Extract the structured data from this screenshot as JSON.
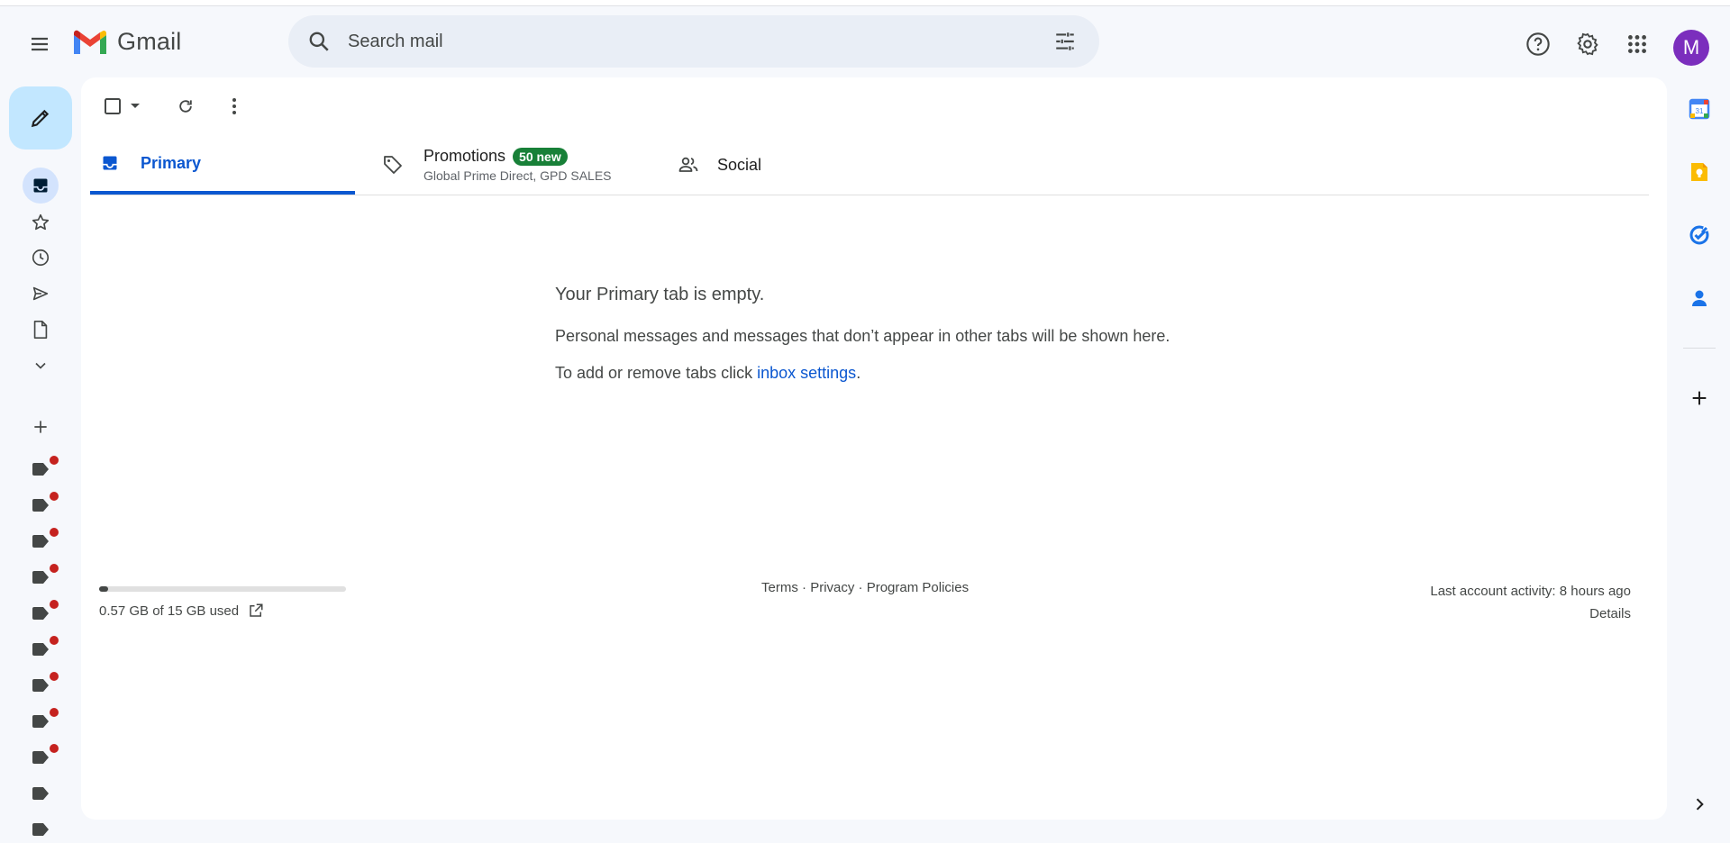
{
  "header": {
    "logo_text": "Gmail",
    "search_placeholder": "Search mail",
    "avatar_letter": "M"
  },
  "toolbar": {},
  "tabs": [
    {
      "label": "Primary"
    },
    {
      "label": "Promotions",
      "badge": "50 new",
      "subtitle": "Global Prime Direct, GPD SALES"
    },
    {
      "label": "Social"
    }
  ],
  "empty_state": {
    "title": "Your Primary tab is empty.",
    "line1": "Personal messages and messages that don’t appear in other tabs will be shown here.",
    "line2_prefix": "To add or remove tabs click ",
    "line2_link": "inbox settings",
    "line2_suffix": "."
  },
  "footer": {
    "storage_text": "0.57 GB of 15 GB used",
    "storage_fraction": 0.038,
    "terms": "Terms",
    "privacy": "Privacy",
    "program_policies": "Program Policies",
    "separator": " · ",
    "last_activity": "Last account activity: 8 hours ago",
    "details": "Details"
  },
  "colors": {
    "accent": "#0b57d0",
    "compose_bg": "#c2e7ff",
    "badge_green": "#188038",
    "label_dot": "#c5221f",
    "avatar": "#7b2ebd"
  },
  "icons": {
    "rail": [
      "inbox-icon",
      "star-icon",
      "clock-icon",
      "send-icon",
      "draft-icon",
      "chevron-down-icon"
    ],
    "side_panel": [
      "calendar-icon",
      "keep-icon",
      "tasks-icon",
      "contacts-icon",
      "plus-icon",
      "chevron-right-icon"
    ]
  }
}
